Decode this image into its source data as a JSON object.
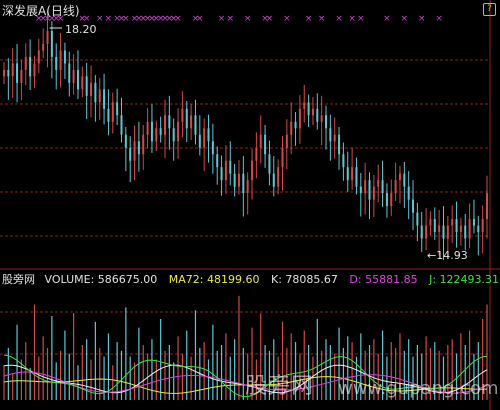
{
  "stock": {
    "title": "深发展A",
    "period": "(日线)"
  },
  "price_panel": {
    "high_label": "18.20",
    "low_label": "←14.93",
    "signal_marker": "×"
  },
  "volume_panel": {
    "indicator_name": "股旁网",
    "readouts": [
      {
        "label": "VOLUME:",
        "value": "586675.00",
        "color": "#e0e0e0"
      },
      {
        "label": "MA72:",
        "value": "48199.60",
        "color": "#e8e84a"
      },
      {
        "label": "K:",
        "value": "78085.67",
        "color": "#e0e0e0"
      },
      {
        "label": "D:",
        "value": "55881.85",
        "color": "#e040e0"
      },
      {
        "label": "J:",
        "value": "122493.31",
        "color": "#40e040"
      }
    ]
  },
  "watermark": {
    "cn": "股旁网",
    "url": "www.gupang.com"
  },
  "colors": {
    "up": "#d24a4a",
    "down": "#5ec8d2",
    "grid": "#8a1f1f",
    "marker": "#d040d0",
    "ma": "#e8e84a",
    "k": "#f0f0f0",
    "d": "#e040e0",
    "j": "#40e040"
  },
  "chart_data": {
    "type": "candlestick",
    "price_extremes": {
      "high": 18.2,
      "low": 14.93
    },
    "close_series": [
      17.6,
      17.5,
      17.7,
      17.4,
      17.6,
      17.8,
      17.5,
      17.7,
      17.9,
      18.0,
      18.2,
      17.8,
      17.6,
      17.9,
      17.7,
      17.4,
      17.6,
      17.3,
      17.5,
      17.2,
      17.4,
      17.1,
      17.3,
      17.0,
      16.8,
      17.1,
      16.9,
      16.6,
      16.4,
      16.2,
      16.5,
      16.3,
      16.6,
      16.8,
      16.5,
      16.7,
      16.6,
      16.9,
      16.7,
      16.5,
      16.8,
      17.0,
      16.7,
      16.9,
      16.6,
      16.4,
      16.7,
      16.5,
      16.3,
      16.1,
      15.9,
      16.2,
      16.0,
      15.8,
      16.0,
      15.7,
      15.9,
      16.2,
      16.4,
      16.6,
      16.3,
      16.0,
      15.8,
      16.1,
      16.4,
      16.6,
      16.8,
      16.7,
      17.0,
      17.1,
      16.9,
      17.0,
      16.8,
      16.9,
      16.7,
      16.5,
      16.6,
      16.3,
      16.1,
      15.9,
      16.1,
      15.8,
      15.7,
      15.9,
      15.6,
      15.8,
      15.9,
      15.7,
      15.5,
      15.7,
      15.9,
      16.0,
      15.8,
      15.6,
      15.4,
      15.2,
      15.0,
      15.2,
      15.3,
      15.1,
      15.2,
      15.0,
      15.2,
      15.3,
      15.1,
      15.2,
      15.0,
      15.3,
      15.2,
      15.1,
      15.3,
      15.7
    ],
    "volume_series": [
      120,
      180,
      90,
      260,
      140,
      200,
      110,
      330,
      150,
      220,
      180,
      290,
      130,
      170,
      240,
      160,
      300,
      120,
      190,
      210,
      140,
      270,
      180,
      150,
      230,
      120,
      200,
      170,
      320,
      150,
      130,
      250,
      190,
      160,
      210,
      140,
      280,
      170,
      190,
      130,
      220,
      160,
      240,
      150,
      310,
      180,
      200,
      140,
      260,
      170,
      190,
      230,
      150,
      210,
      360,
      180,
      160,
      250,
      140,
      300,
      190,
      170,
      210,
      150,
      270,
      180,
      230,
      200,
      160,
      240,
      190,
      150,
      280,
      170,
      210,
      190,
      160,
      250,
      180,
      220,
      200,
      150,
      230,
      170,
      190,
      210,
      160,
      240,
      150,
      200,
      180,
      230,
      170,
      210,
      150,
      190,
      160,
      220,
      180,
      200,
      170,
      150,
      190,
      210,
      160,
      230,
      190,
      240,
      160,
      200,
      280,
      330
    ]
  }
}
